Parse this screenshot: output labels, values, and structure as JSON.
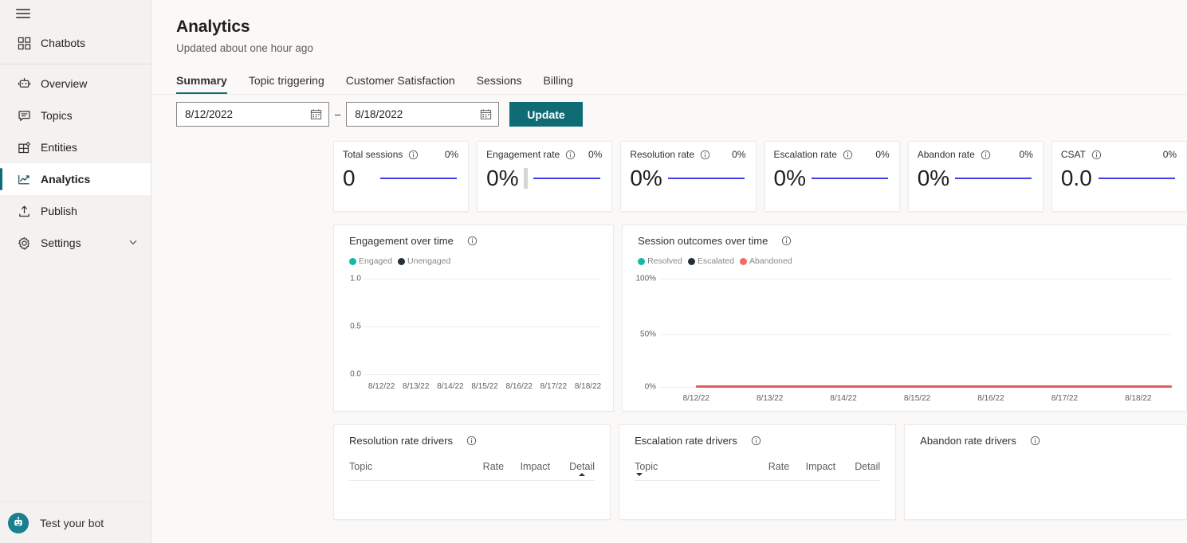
{
  "sidebar": {
    "menu_icon": "hamburger-icon",
    "top_items": [
      {
        "label": "Chatbots",
        "icon": "grid-icon"
      }
    ],
    "items": [
      {
        "label": "Overview",
        "icon": "bot-icon",
        "active": false
      },
      {
        "label": "Topics",
        "icon": "chat-bubble-icon",
        "active": false
      },
      {
        "label": "Entities",
        "icon": "entities-icon",
        "active": false
      },
      {
        "label": "Analytics",
        "icon": "line-chart-icon",
        "active": true
      },
      {
        "label": "Publish",
        "icon": "upload-icon",
        "active": false
      },
      {
        "label": "Settings",
        "icon": "gear-icon",
        "active": false,
        "chevron": "chevron-down-icon"
      }
    ],
    "footer": {
      "label": "Test your bot",
      "icon": "bot-avatar-icon"
    }
  },
  "header": {
    "title": "Analytics",
    "subtitle": "Updated about one hour ago"
  },
  "tabs": [
    {
      "label": "Summary",
      "active": true
    },
    {
      "label": "Topic triggering",
      "active": false
    },
    {
      "label": "Customer Satisfaction",
      "active": false
    },
    {
      "label": "Sessions",
      "active": false
    },
    {
      "label": "Billing",
      "active": false
    }
  ],
  "filters": {
    "start_date": "8/12/2022",
    "end_date": "8/18/2022",
    "separator": "–",
    "calendar_icon": "calendar-icon",
    "update_label": "Update"
  },
  "kpis": [
    {
      "name": "Total sessions",
      "delta": "0%",
      "value": "0",
      "has_bar": false
    },
    {
      "name": "Engagement rate",
      "delta": "0%",
      "value": "0%",
      "has_bar": true
    },
    {
      "name": "Resolution rate",
      "delta": "0%",
      "value": "0%",
      "has_bar": false
    },
    {
      "name": "Escalation rate",
      "delta": "0%",
      "value": "0%",
      "has_bar": false
    },
    {
      "name": "Abandon rate",
      "delta": "0%",
      "value": "0%",
      "has_bar": false
    },
    {
      "name": "CSAT",
      "delta": "0%",
      "value": "0.0",
      "has_bar": false
    }
  ],
  "charts": {
    "engagement": {
      "title": "Engagement over time",
      "legend": [
        {
          "label": "Engaged",
          "color": "#17b8a6"
        },
        {
          "label": "Unengaged",
          "color": "#23313a"
        }
      ]
    },
    "outcomes": {
      "title": "Session outcomes over time",
      "legend": [
        {
          "label": "Resolved",
          "color": "#17b8a6"
        },
        {
          "label": "Escalated",
          "color": "#23313a"
        },
        {
          "label": "Abandoned",
          "color": "#f46a6a"
        }
      ]
    }
  },
  "drivers": [
    {
      "title": "Resolution rate drivers",
      "has_table": true,
      "columns": [
        "Topic",
        "Rate",
        "Impact",
        "Detail"
      ],
      "sort_column": "Detail",
      "sort_direction": "up",
      "rows": []
    },
    {
      "title": "Escalation rate drivers",
      "has_table": true,
      "columns": [
        "Topic",
        "Rate",
        "Impact",
        "Detail"
      ],
      "sort_column": "Topic",
      "sort_direction": "down",
      "rows": []
    },
    {
      "title": "Abandon rate drivers",
      "has_table": false,
      "columns": [],
      "rows": []
    }
  ],
  "colors": {
    "accent_teal": "#0f6c75",
    "sparkline_blue": "#4040e0",
    "abandoned_red": "#e05c5c",
    "engaged_teal": "#17b8a6",
    "unengaged_dark": "#23313a"
  },
  "chart_data": [
    {
      "type": "line",
      "title": "Engagement over time",
      "xlabel": "",
      "ylabel": "",
      "x": [
        "8/12/22",
        "8/13/22",
        "8/14/22",
        "8/15/22",
        "8/16/22",
        "8/17/22",
        "8/18/22"
      ],
      "yticks": [
        "0.0",
        "0.5",
        "1.0"
      ],
      "ylim": [
        0,
        1
      ],
      "grid": true,
      "legend_position": "top-left",
      "series": [
        {
          "name": "Engaged",
          "color": "#17b8a6",
          "values": [
            null,
            null,
            null,
            null,
            null,
            null,
            null
          ]
        },
        {
          "name": "Unengaged",
          "color": "#23313a",
          "values": [
            null,
            null,
            null,
            null,
            null,
            null,
            null
          ]
        }
      ]
    },
    {
      "type": "line",
      "title": "Session outcomes over time",
      "xlabel": "",
      "ylabel": "",
      "x": [
        "8/12/22",
        "8/13/22",
        "8/14/22",
        "8/15/22",
        "8/16/22",
        "8/17/22",
        "8/18/22"
      ],
      "yticks": [
        "0%",
        "50%",
        "100%"
      ],
      "ylim": [
        0,
        100
      ],
      "grid": true,
      "legend_position": "top-left",
      "series": [
        {
          "name": "Resolved",
          "color": "#17b8a6",
          "values": [
            0,
            0,
            0,
            0,
            0,
            0,
            0
          ]
        },
        {
          "name": "Escalated",
          "color": "#23313a",
          "values": [
            0,
            0,
            0,
            0,
            0,
            0,
            0
          ]
        },
        {
          "name": "Abandoned",
          "color": "#e05c5c",
          "values": [
            0,
            0,
            0,
            0,
            0,
            0,
            0
          ]
        }
      ]
    }
  ]
}
